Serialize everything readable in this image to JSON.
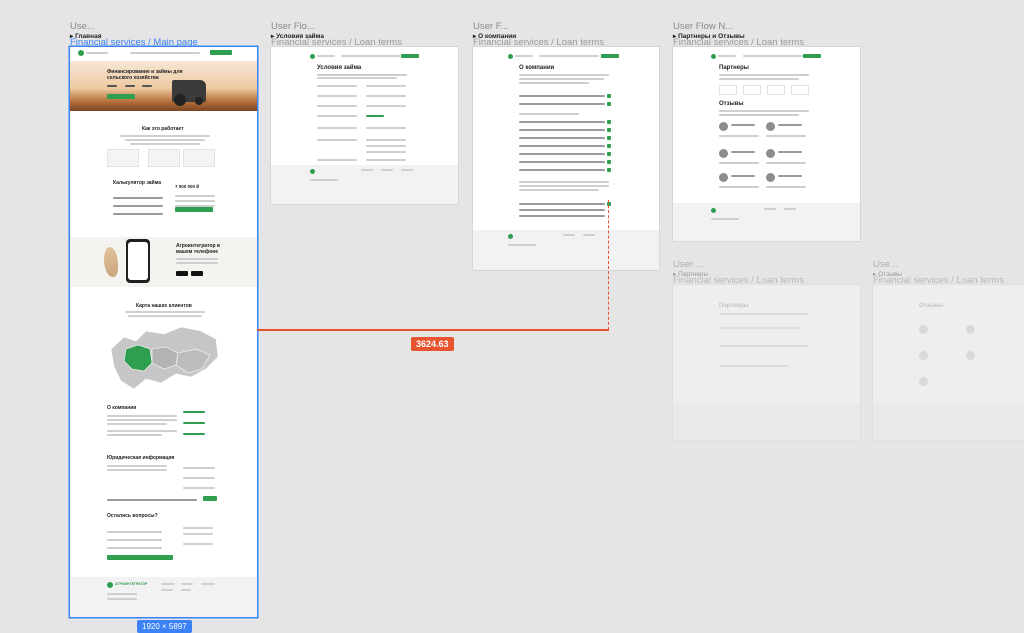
{
  "colors": {
    "canvas": "#e5e5e5",
    "accent_green": "#2e9e4f",
    "selection_blue": "#3b82f6",
    "measure_red": "#e8532f"
  },
  "frames": [
    {
      "id": "main",
      "title": "Use...",
      "flow_start": "▸ Главная",
      "subtitle": "Financial services / Main page"
    },
    {
      "id": "loan-terms",
      "title": "User Flo...",
      "flow_start": "▸ Условия займа",
      "subtitle": "Financial services / Loan terms"
    },
    {
      "id": "about",
      "title": "User F...",
      "flow_start": "▸ О компании",
      "subtitle": "Financial services / Loan terms"
    },
    {
      "id": "partners",
      "title": "User Flow N...",
      "flow_start": "▸ Партнеры и Отзывы",
      "subtitle": "Financial services / Loan terms"
    },
    {
      "id": "faded-1",
      "title": "User ...",
      "flow_start": "▸ Партнеры",
      "subtitle": "Financial services / Loan terms"
    },
    {
      "id": "faded-2",
      "title": "Use...",
      "flow_start": "▸ Отзывы",
      "subtitle": "Financial services / Loan terms"
    }
  ],
  "main_page": {
    "hero_title": "Финансирование и займы для сельского хозяйства",
    "how_title": "Как это работает",
    "calc_title": "Калькулятор займа",
    "calc_amount": "7 000 000 ₽",
    "app_title": "Агроинтегратор в вашем телефоне",
    "map_title": "Карта наших клиентов",
    "about_title": "О компании",
    "legal_title": "Юридическая информация",
    "questions_title": "Остались вопросы?",
    "logo_text": "АГРОИНТЕГРАТОР"
  },
  "loan_terms_page": {
    "title": "Условия займа"
  },
  "about_page": {
    "title": "О компании"
  },
  "partners_page": {
    "title": "Партнеры",
    "reviews_title": "Отзывы"
  },
  "measurement": {
    "distance": "3624.63",
    "selection_size": "1920 × 5897"
  }
}
